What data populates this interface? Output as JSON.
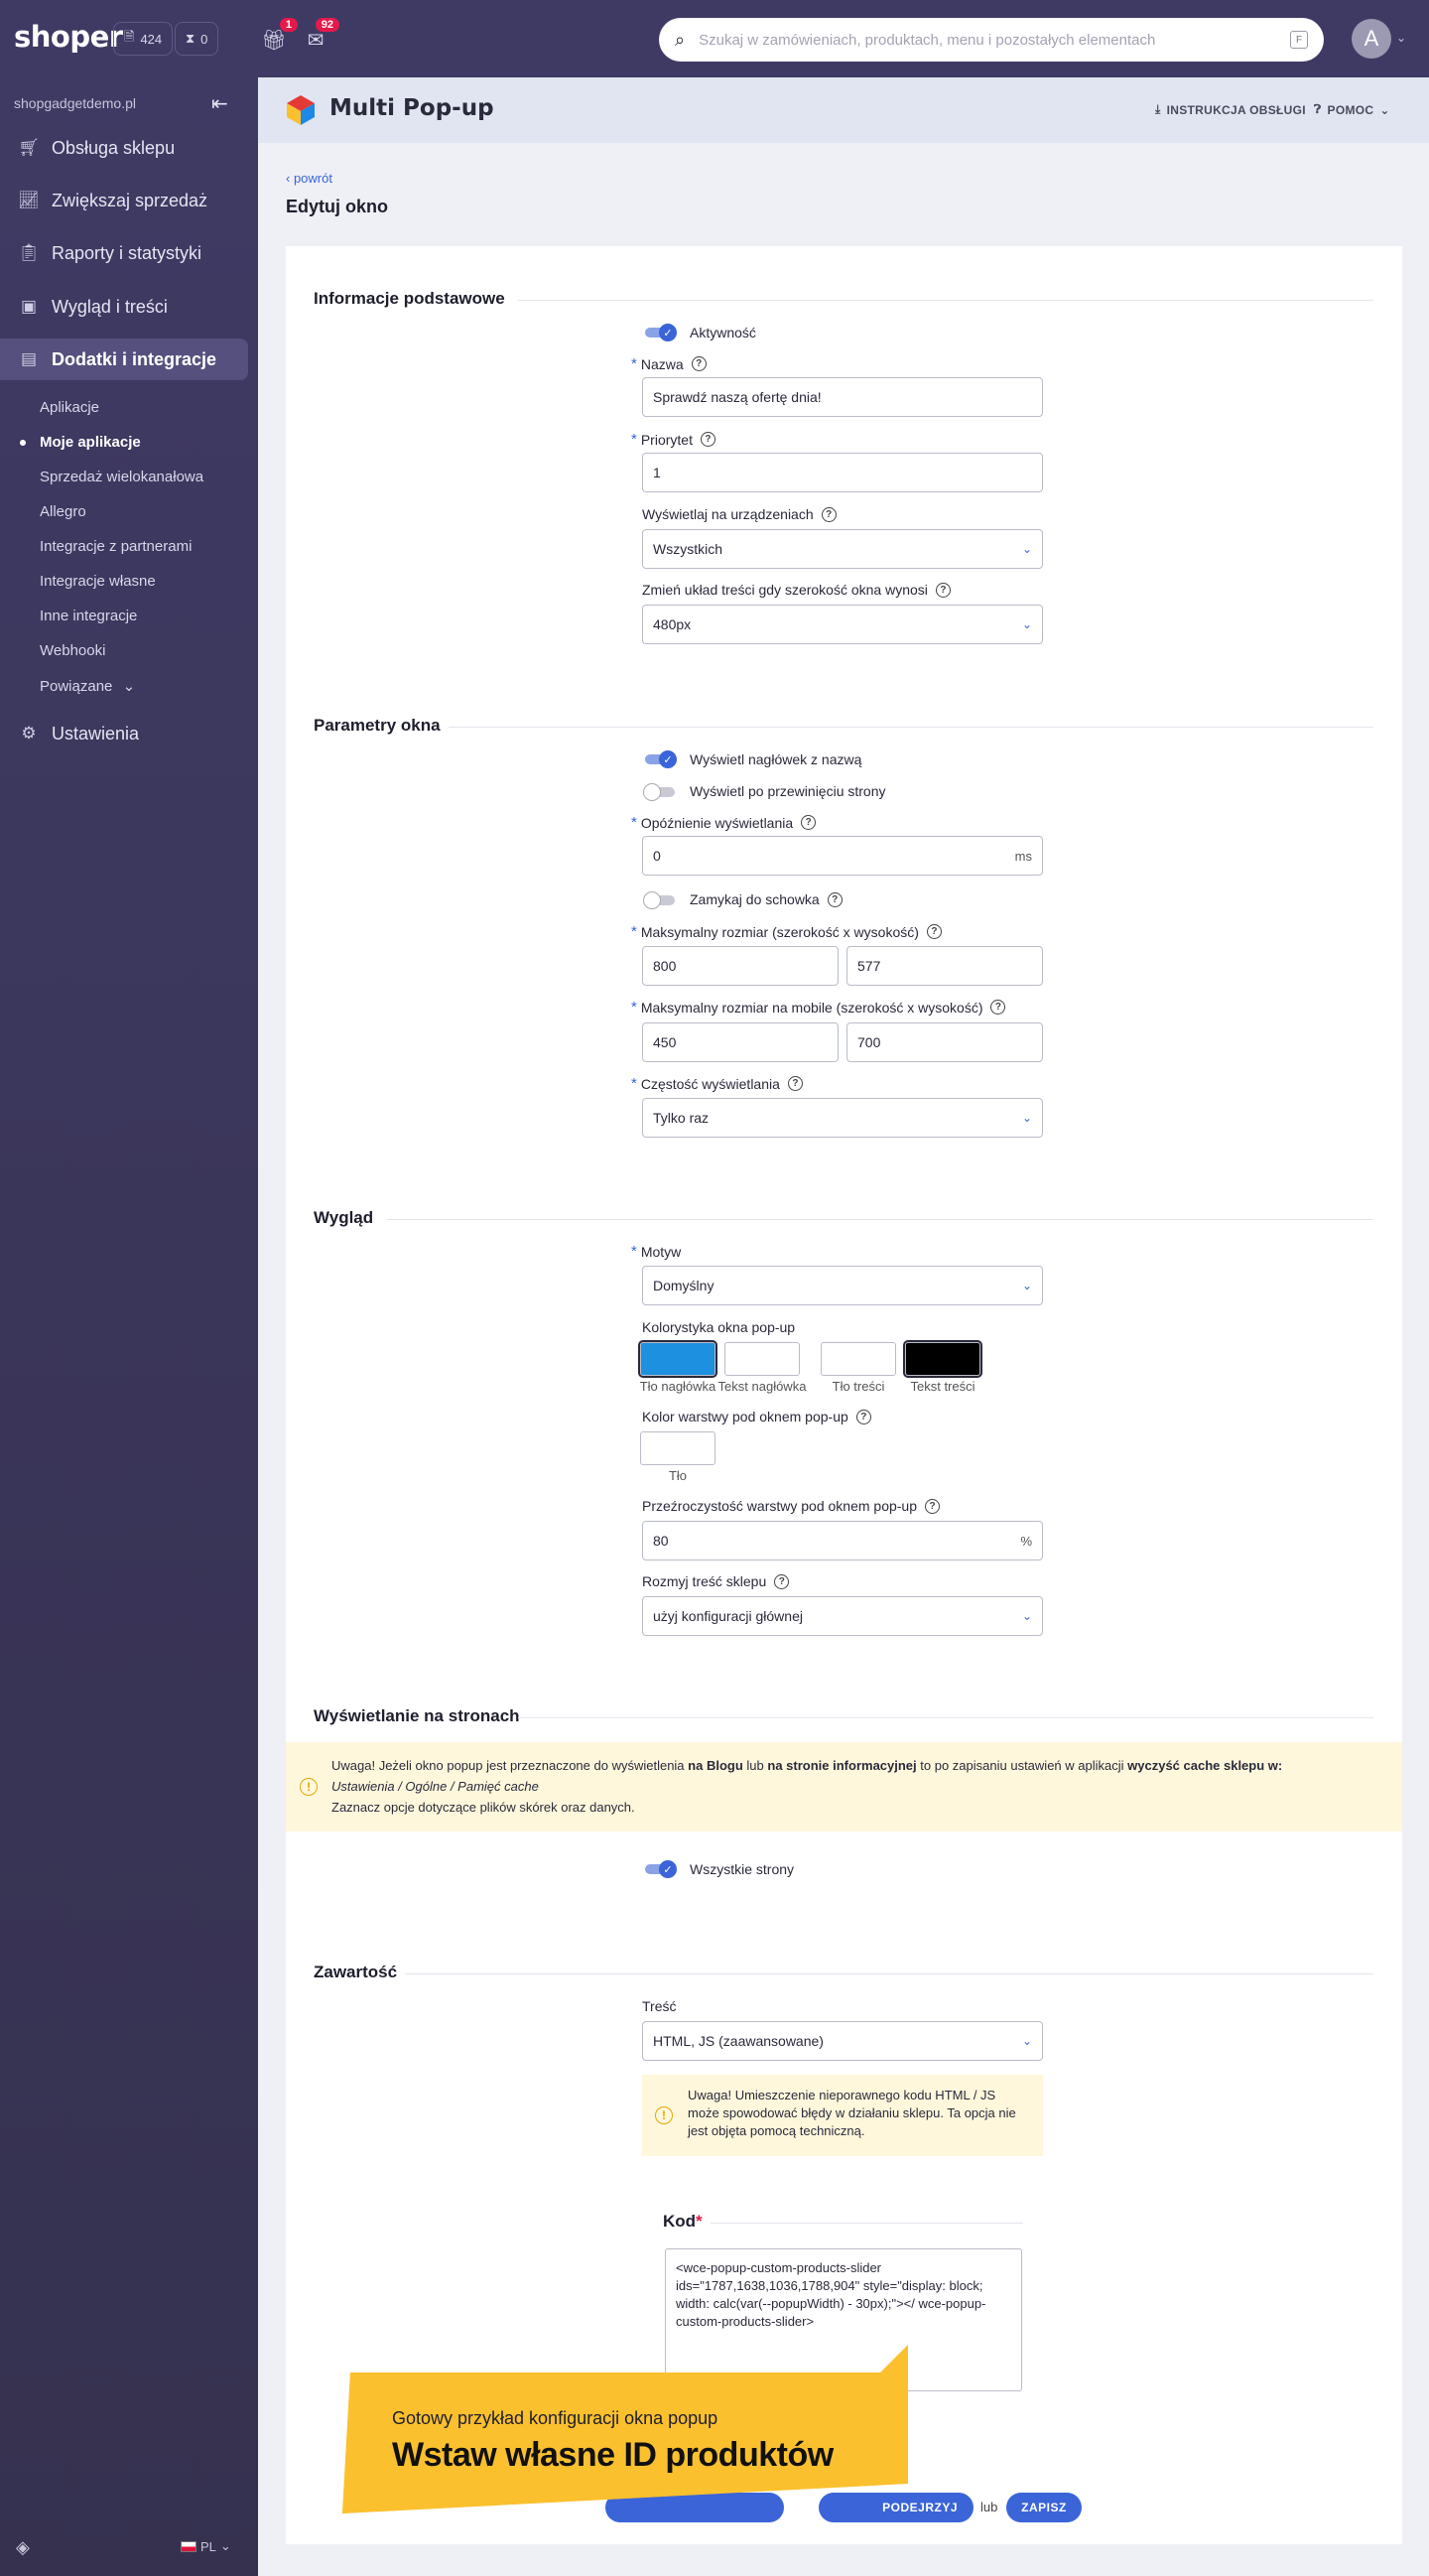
{
  "topbar": {
    "logo": "shoper",
    "pill_orders_count": "424",
    "pill_hourglass_count": "0",
    "gift_badge": "1",
    "mail_badge": "92",
    "search_placeholder": "Szukaj w zamówieniach, produktach, menu i pozostałych elementach",
    "search_shortcut": "F",
    "avatar_letter": "A"
  },
  "sidebar": {
    "domain": "shopgadgetdemo.pl",
    "nav": [
      {
        "label": "Obsługa sklepu",
        "icon": "cart-icon"
      },
      {
        "label": "Zwiększaj sprzedaż",
        "icon": "chart-icon"
      },
      {
        "label": "Raporty i statystyki",
        "icon": "report-icon"
      },
      {
        "label": "Wygląd i treści",
        "icon": "image-icon"
      },
      {
        "label": "Dodatki i integracje",
        "icon": "apps-icon"
      },
      {
        "label": "Ustawienia",
        "icon": "gear-icon"
      }
    ],
    "sub": [
      "Aplikacje",
      "Moje aplikacje",
      "Sprzedaż wielokanałowa",
      "Allegro",
      "Integracje z partnerami",
      "Integracje własne",
      "Inne integracje",
      "Webhooki",
      "Powiązane"
    ],
    "lang": "PL"
  },
  "appbar": {
    "title": "Multi Pop-up",
    "manual": "INSTRUKCJA OBSŁUGI",
    "help": "POMOC"
  },
  "page": {
    "back": "powrót",
    "title": "Edytuj okno"
  },
  "sections": {
    "basic": "Informacje podstawowe",
    "params": "Parametry okna",
    "look": "Wygląd",
    "pages": "Wyświetlanie na stronach",
    "content": "Zawartość"
  },
  "basic": {
    "active_label": "Aktywność",
    "name_label": "Nazwa",
    "name_value": "Sprawdź naszą ofertę dnia!",
    "priority_label": "Priorytet",
    "priority_value": "1",
    "devices_label": "Wyświetlaj na urządzeniach",
    "devices_value": "Wszystkich",
    "layout_label": "Zmień układ treści gdy szerokość okna wynosi",
    "layout_value": "480px"
  },
  "params": {
    "show_header_label": "Wyświetl nagłówek z nazwą",
    "show_on_scroll_label": "Wyświetl po przewinięciu strony",
    "delay_label": "Opóźnienie wyświetlania",
    "delay_value": "0",
    "delay_unit": "ms",
    "close_label": "Zamykaj do schowka",
    "max_size_label": "Maksymalny rozmiar (szerokość x wysokość)",
    "max_w": "800",
    "max_h": "577",
    "max_mobile_label": "Maksymalny rozmiar na mobile (szerokość x wysokość)",
    "mob_w": "450",
    "mob_h": "700",
    "freq_label": "Częstość wyświetlania",
    "freq_value": "Tylko raz"
  },
  "look": {
    "theme_label": "Motyw",
    "theme_value": "Domyślny",
    "colors_label": "Kolorystyka okna pop-up",
    "swatches": [
      {
        "label": "Tło nagłówka",
        "color": "#1e90e0"
      },
      {
        "label": "Tekst nagłówka",
        "color": "#ffffff"
      },
      {
        "label": "Tło treści",
        "color": "#ffffff"
      },
      {
        "label": "Tekst treści",
        "color": "#000000"
      }
    ],
    "overlay_color_label": "Kolor warstwy pod oknem pop-up",
    "overlay_swatch_label": "Tło",
    "overlay_swatch_color": "#ffffff",
    "opacity_label": "Przeźroczystość warstwy pod oknem pop-up",
    "opacity_value": "80",
    "opacity_unit": "%",
    "blur_label": "Rozmyj treść sklepu",
    "blur_value": "użyj konfiguracji głównej"
  },
  "pages": {
    "notice_part1": "Uwaga! Jeżeli okno popup jest przeznaczone do wyświetlenia",
    "notice_b1": "na Blogu",
    "notice_part2": "lub",
    "notice_b2": "na stronie informacyjnej",
    "notice_part3": "to po zapisaniu ustawień w aplikacji",
    "notice_b3": "wyczyść cache sklepu w:",
    "notice_path": "Ustawienia / Ogólne / Pamięć cache",
    "notice_line3": "Zaznacz opcje dotyczące plików skórek oraz danych.",
    "all_pages_label": "Wszystkie strony"
  },
  "content": {
    "type_label": "Treść",
    "type_value": "HTML, JS (zaawansowane)",
    "warning": "Uwaga! Umieszczenie nieporawnego kodu HTML / JS może spowodować błędy w działaniu sklepu. Ta opcja nie jest objęta pomocą techniczną.",
    "code_label": "Kod",
    "code_value": "<wce-popup-custom-products-slider ids=\"1787,1638,1036,1788,904\" style=\"display: block; width: calc(var(--popupWidth) - 30px);\"></ wce-popup-custom-products-slider>"
  },
  "footer": {
    "preview_label": "PODEJRZYJ",
    "or": "lub",
    "save_label": "ZAPISZ"
  },
  "banner": {
    "subtitle": "Gotowy przykład konfiguracji okna popup",
    "title": "Wstaw własne ID produktów",
    "color": "#fbc02d"
  }
}
